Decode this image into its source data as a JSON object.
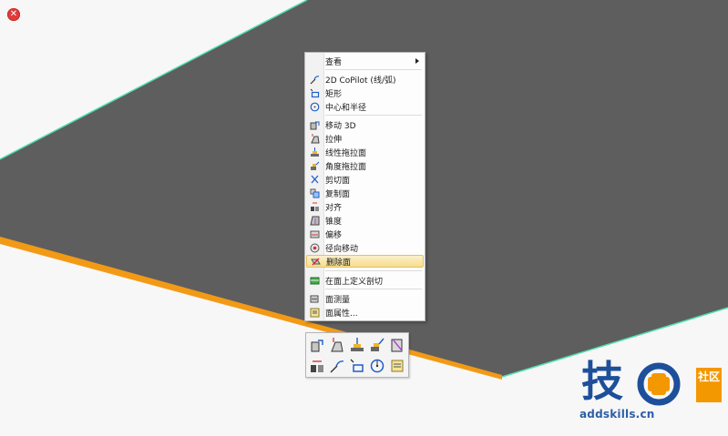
{
  "context_menu": {
    "items": [
      {
        "label": "查看",
        "icon": "view-icon"
      },
      {
        "label": "2D CoPilot (线/弧)",
        "icon": "line-arc-icon"
      },
      {
        "label": "矩形",
        "icon": "rectangle-icon"
      },
      {
        "label": "中心和半径",
        "icon": "circle-center-radius-icon"
      },
      {
        "label": "移动 3D",
        "icon": "move-3d-icon"
      },
      {
        "label": "拉伸",
        "icon": "extrude-icon"
      },
      {
        "label": "线性拖拉面",
        "icon": "linear-pull-face-icon"
      },
      {
        "label": "角度拖拉面",
        "icon": "angular-pull-face-icon"
      },
      {
        "label": "剪切面",
        "icon": "cut-face-icon"
      },
      {
        "label": "复制面",
        "icon": "copy-face-icon"
      },
      {
        "label": "对齐",
        "icon": "align-icon"
      },
      {
        "label": "锥度",
        "icon": "taper-icon"
      },
      {
        "label": "偏移",
        "icon": "offset-icon"
      },
      {
        "label": "径向移动",
        "icon": "radial-move-icon"
      },
      {
        "label": "删除面",
        "icon": "delete-face-icon"
      },
      {
        "label": "在面上定义剖切",
        "icon": "define-section-icon"
      },
      {
        "label": "面测量",
        "icon": "face-measure-icon"
      },
      {
        "label": "面属性...",
        "icon": "face-properties-icon"
      }
    ],
    "highlighted": "删除面"
  },
  "mini_toolbar": {
    "buttons": [
      "move-3d-icon",
      "extrude-icon",
      "linear-pull-face-icon",
      "angular-pull-face-icon",
      "cut-face-icon",
      "align-icon",
      "line-arc-icon",
      "rectangle-icon",
      "circle-center-radius-icon",
      "face-properties-icon"
    ]
  },
  "watermark": {
    "logo_char": "技",
    "badge_text": "社区",
    "url": "addskills.cn"
  },
  "colors": {
    "face": "#5e5e5e",
    "edge_orange": "#f29a16",
    "edge_green": "#4fe0b0",
    "highlight": "#f8e3a0",
    "logo_blue": "#1d4f9a",
    "logo_orange": "#f39800"
  }
}
